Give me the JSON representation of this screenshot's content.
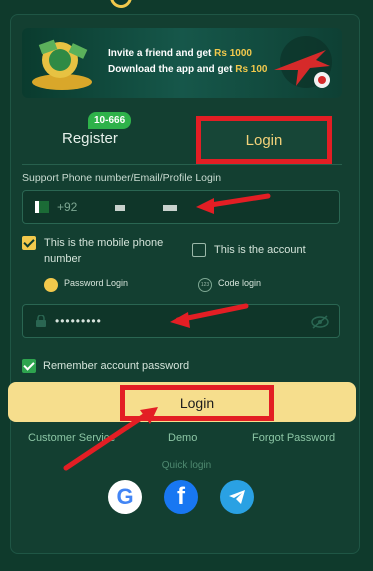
{
  "banner": {
    "line1_prefix": "Invite a friend and get",
    "line1_amount": "Rs 1000",
    "line2_prefix": "Download the app and get",
    "line2_amount": "Rs 100"
  },
  "tabs": {
    "register_label": "Register",
    "register_badge": "10-666",
    "login_label": "Login"
  },
  "phone": {
    "label": "Support Phone number/Email/Profile Login",
    "country_code": "+92"
  },
  "options": {
    "mobile_label_line1": "This is the mobile phone",
    "mobile_label_line2": "number",
    "account_label": "This is the account",
    "password_login_label": "Password Login",
    "code_login_label": "Code login",
    "code_badge": "123"
  },
  "password": {
    "masked_value": "•••••••••"
  },
  "remember": {
    "label": "Remember account password"
  },
  "actions": {
    "login_label": "Login",
    "customer_service": "Customer Service",
    "demo": "Demo",
    "forgot_password": "Forgot Password"
  },
  "quick_login": {
    "label": "Quick login",
    "providers": [
      "google-icon",
      "facebook-icon",
      "telegram-icon"
    ]
  },
  "colors": {
    "background": "#0f3a2c",
    "accent_gold": "#f2c94c",
    "button_gold": "#f6de8d",
    "annotation_red": "#e31e24",
    "link_green": "#8cc6a5"
  }
}
